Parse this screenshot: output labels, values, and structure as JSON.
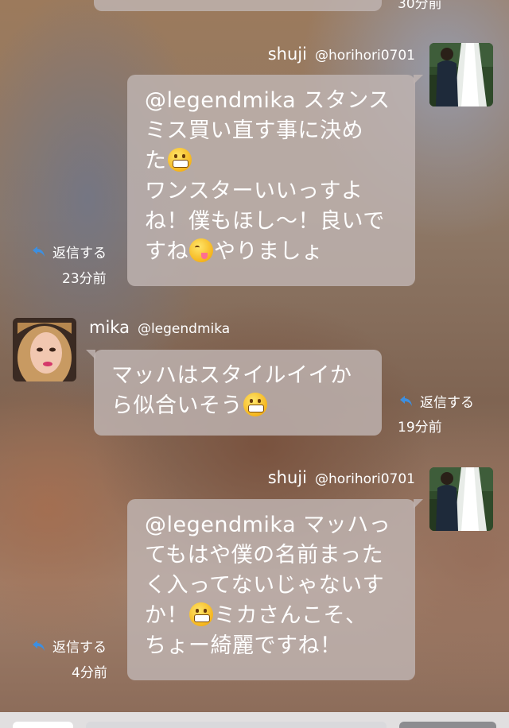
{
  "top_partial": {
    "time": "30分前"
  },
  "messages": [
    {
      "user": "shuji",
      "handle": "@horihori0701",
      "lines": [
        "@legendmika スタンス",
        "ミス買い直す事に決め",
        "た",
        "ワンスターいいっすよ",
        "ね！僕もほし〜！良いで",
        "すね",
        "やりましょ"
      ],
      "reply_label": "返信する",
      "time": "23分前"
    },
    {
      "user": "mika",
      "handle": "@legendmika",
      "lines": [
        "マッハはスタイルイイか",
        "ら似合いそう"
      ],
      "reply_label": "返信する",
      "time": "19分前"
    },
    {
      "user": "shuji",
      "handle": "@horihori0701",
      "lines": [
        "@legendmika マッハっ",
        "てもはや僕の名前まった",
        "く入ってないじゃないす",
        "か！",
        "ミカさんこそ、",
        "ちょー綺麗ですね！"
      ],
      "reply_label": "返信する",
      "time": "4分前"
    }
  ],
  "icons": {
    "reply": "reply-arrow-icon",
    "emoji_grin": "grinning-face-emoji",
    "emoji_yum": "yum-face-emoji"
  },
  "colors": {
    "reply_icon": "#3d8fe0",
    "bubble": "#c0b4b2"
  }
}
